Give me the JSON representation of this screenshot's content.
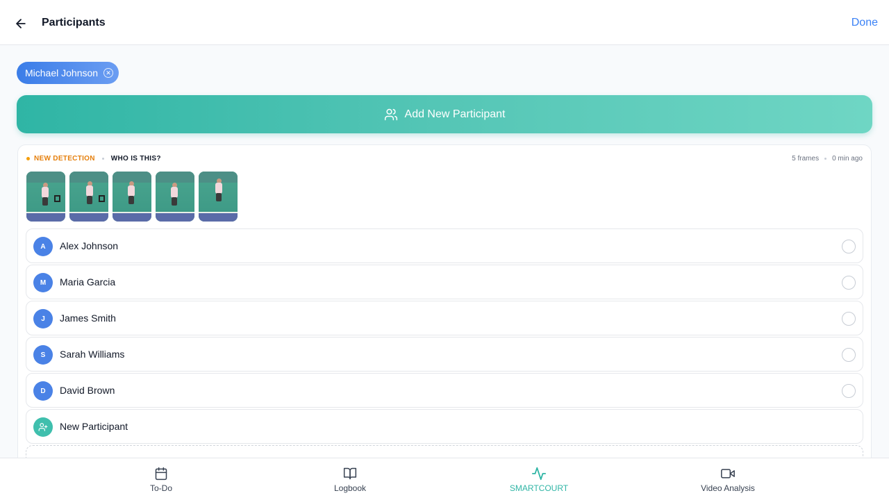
{
  "header": {
    "title": "Participants",
    "done_label": "Done"
  },
  "selected": {
    "chip_label": "Michael Johnson"
  },
  "add_button": {
    "label": "Add New Participant"
  },
  "detection": {
    "label": "NEW DETECTION",
    "question": "WHO IS THIS?",
    "frames_text": "5 frames",
    "time_text": "0 min ago",
    "frame_count": 5
  },
  "participants": [
    {
      "initial": "A",
      "name": "Alex Johnson"
    },
    {
      "initial": "M",
      "name": "Maria Garcia"
    },
    {
      "initial": "J",
      "name": "James Smith"
    },
    {
      "initial": "S",
      "name": "Sarah Williams"
    },
    {
      "initial": "D",
      "name": "David Brown"
    }
  ],
  "new_participant": {
    "name": "New Participant",
    "icon": "user-plus-icon"
  },
  "nav": {
    "items": [
      {
        "label": "To-Do",
        "icon": "calendar-icon"
      },
      {
        "label": "Logbook",
        "icon": "book-open-icon"
      },
      {
        "label": "SMARTCOURT",
        "icon": "activity-icon"
      },
      {
        "label": "Video Analysis",
        "icon": "video-icon"
      }
    ],
    "active_index": 2
  },
  "colors": {
    "accent_blue": "#3b82f6",
    "accent_teal": "#2fb5a5",
    "detection_orange": "#e57f0c"
  }
}
